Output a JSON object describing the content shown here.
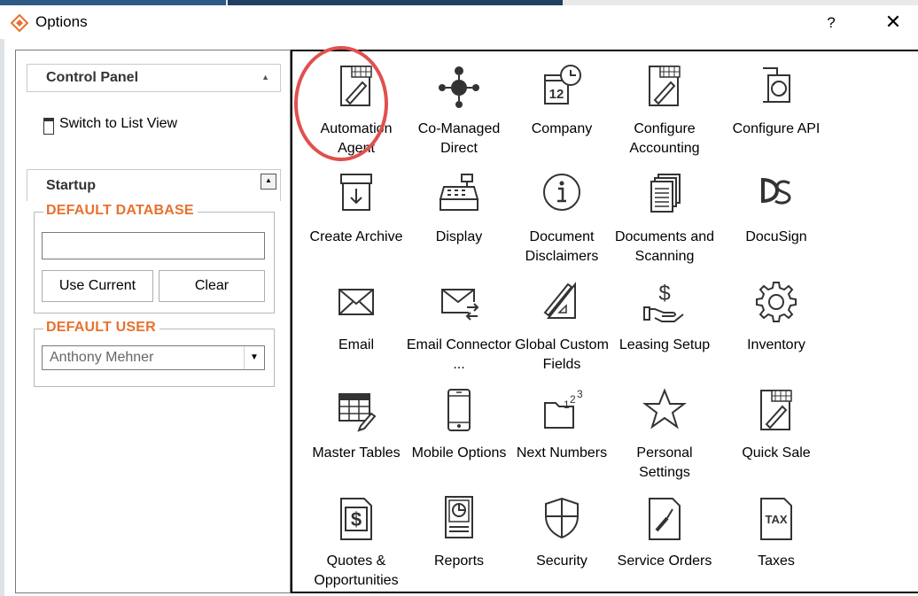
{
  "window": {
    "title": "Options",
    "help_glyph": "?",
    "close_glyph": "✕",
    "accent_color": "#e8712d",
    "highlight_color": "#e0504f"
  },
  "left_panel": {
    "control_panel_title": "Control Panel",
    "switch_view_label": "Switch to List View",
    "startup_title": "Startup",
    "default_database": {
      "legend": "DEFAULT DATABASE",
      "value": "",
      "use_current_label": "Use Current",
      "clear_label": "Clear"
    },
    "default_user": {
      "legend": "DEFAULT USER",
      "selected": "Anthony Mehner"
    }
  },
  "tiles": [
    {
      "label": "Automation Agent",
      "icon": "automation-agent-icon"
    },
    {
      "label": "Co-Managed Direct",
      "icon": "co-managed-direct-icon"
    },
    {
      "label": "Company",
      "icon": "company-calendar-icon"
    },
    {
      "label": "Configure Accounting",
      "icon": "configure-accounting-icon"
    },
    {
      "label": "Configure API",
      "icon": "configure-api-icon"
    },
    {
      "label": "Create Archive",
      "icon": "archive-box-icon"
    },
    {
      "label": "Display",
      "icon": "cash-register-icon"
    },
    {
      "label": "Document Disclaimers",
      "icon": "info-icon"
    },
    {
      "label": "Documents and Scanning",
      "icon": "documents-stack-icon"
    },
    {
      "label": "DocuSign",
      "icon": "docusign-icon"
    },
    {
      "label": "Email",
      "icon": "envelope-icon"
    },
    {
      "label": "Email Connector ...",
      "icon": "email-connector-icon"
    },
    {
      "label": "Global Custom Fields",
      "icon": "ruler-triangle-icon"
    },
    {
      "label": "Leasing Setup",
      "icon": "dollar-hand-icon"
    },
    {
      "label": "Inventory",
      "icon": "gear-icon"
    },
    {
      "label": "Master Tables",
      "icon": "table-grid-icon"
    },
    {
      "label": "Mobile Options",
      "icon": "mobile-phone-icon"
    },
    {
      "label": "Next Numbers",
      "icon": "folder-numbers-icon"
    },
    {
      "label": "Personal Settings",
      "icon": "star-icon"
    },
    {
      "label": "Quick Sale",
      "icon": "quick-sale-icon"
    },
    {
      "label": "Quotes & Opportunities",
      "icon": "dollar-document-icon"
    },
    {
      "label": "Reports",
      "icon": "report-chart-icon"
    },
    {
      "label": "Security",
      "icon": "shield-icon"
    },
    {
      "label": "Service Orders",
      "icon": "screwdriver-icon"
    },
    {
      "label": "Taxes",
      "icon": "tax-document-icon"
    }
  ]
}
